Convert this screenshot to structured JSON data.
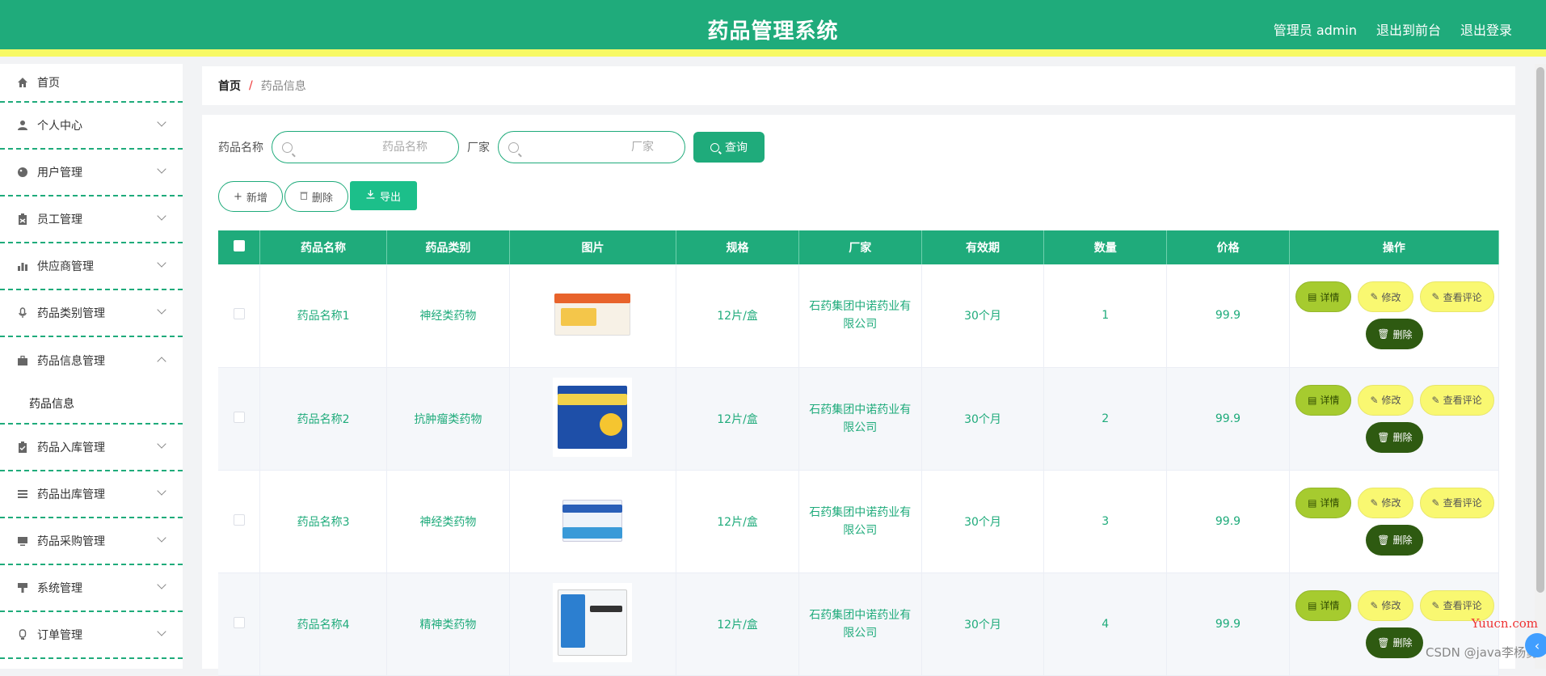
{
  "header": {
    "title": "药品管理系统",
    "admin_label": "管理员 admin",
    "to_front": "退出到前台",
    "logout": "退出登录"
  },
  "sidebar": {
    "items": [
      {
        "label": "首页",
        "icon": "home-icon"
      },
      {
        "label": "个人中心",
        "icon": "user-icon"
      },
      {
        "label": "用户管理",
        "icon": "palette-icon"
      },
      {
        "label": "员工管理",
        "icon": "clipboard-icon"
      },
      {
        "label": "供应商管理",
        "icon": "bar-chart-icon"
      },
      {
        "label": "药品类别管理",
        "icon": "microphone-icon"
      },
      {
        "label": "药品信息管理",
        "icon": "briefcase-icon"
      },
      {
        "label": "药品入库管理",
        "icon": "clipboard-check-icon"
      },
      {
        "label": "药品出库管理",
        "icon": "list-icon"
      },
      {
        "label": "药品采购管理",
        "icon": "monitor-icon"
      },
      {
        "label": "系统管理",
        "icon": "brush-icon"
      },
      {
        "label": "订单管理",
        "icon": "bulb-icon"
      }
    ],
    "submenu_active": "药品信息"
  },
  "breadcrumb": {
    "home": "首页",
    "sep": "/",
    "current": "药品信息"
  },
  "search": {
    "name_label": "药品名称",
    "name_placeholder": "药品名称",
    "maker_label": "厂家",
    "maker_placeholder": "厂家",
    "query_button": "查询"
  },
  "actions": {
    "add": "新增",
    "delete": "删除",
    "export": "导出"
  },
  "table": {
    "columns": [
      "药品名称",
      "药品类别",
      "图片",
      "规格",
      "厂家",
      "有效期",
      "数量",
      "价格",
      "操作"
    ],
    "rows": [
      {
        "name": "药品名称1",
        "category": "神经类药物",
        "spec": "12片/盒",
        "maker": "石药集团中诺药业有限公司",
        "validity": "30个月",
        "qty": "1",
        "price": "99.9"
      },
      {
        "name": "药品名称2",
        "category": "抗肿瘤类药物",
        "spec": "12片/盒",
        "maker": "石药集团中诺药业有限公司",
        "validity": "30个月",
        "qty": "2",
        "price": "99.9"
      },
      {
        "name": "药品名称3",
        "category": "神经类药物",
        "spec": "12片/盒",
        "maker": "石药集团中诺药业有限公司",
        "validity": "30个月",
        "qty": "3",
        "price": "99.9"
      },
      {
        "name": "药品名称4",
        "category": "精神类药物",
        "spec": "12片/盒",
        "maker": "石药集团中诺药业有限公司",
        "validity": "30个月",
        "qty": "4",
        "price": "99.9"
      }
    ],
    "ops": {
      "detail": "详情",
      "edit": "修改",
      "review": "查看评论",
      "del": "删除"
    }
  },
  "watermark": {
    "site": "Yuucn.com",
    "author": "CSDN @java李杨勇"
  },
  "colors": {
    "primary": "#1fab7b",
    "accent_bar": "#f7f964",
    "detail_btn": "#a6cb2f",
    "edit_btn": "#f9f871",
    "delete_btn": "#2e5a11"
  }
}
